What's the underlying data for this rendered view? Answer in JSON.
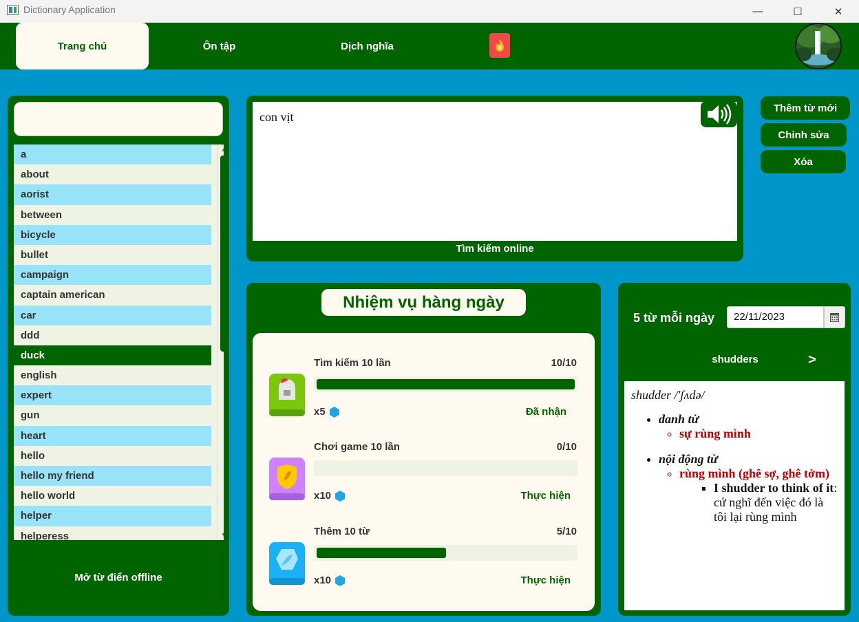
{
  "window": {
    "title": "Dictionary Application",
    "controls": [
      "—",
      "☐",
      "✕"
    ]
  },
  "nav": {
    "tabs": [
      "Trang chủ",
      "Ôn tập",
      "Dịch nghĩa"
    ],
    "active_tab": "Trang chủ",
    "fire_icon": "fire-icon",
    "avatar": "waterfall-avatar"
  },
  "search": {
    "value": "",
    "placeholder": ""
  },
  "word_list": {
    "items": [
      "a",
      "about",
      "aorist",
      "between",
      "bicycle",
      "bullet",
      "campaign",
      "captain american",
      "car",
      "ddd",
      "duck",
      "english",
      "expert",
      "gun",
      "heart",
      "hello",
      "hello my friend",
      "hello world",
      "helper",
      "helperess"
    ],
    "selected": "duck",
    "offline_button": "Mở từ điển offline"
  },
  "translate": {
    "input_text": "con vịt",
    "online_search": "Tìm kiếm online",
    "speaker_icon": "speaker-icon"
  },
  "actions": {
    "add": "Thêm từ mới",
    "edit": "Chỉnh sửa",
    "delete": "Xóa"
  },
  "quests": {
    "title": "Nhiệm vụ hàng ngày",
    "items": [
      {
        "name": "Tìm kiếm 10 lần",
        "progress": "10/10",
        "fraction": 1.0,
        "reward": "x5",
        "status": "Đã nhận",
        "icon": "helmet-icon",
        "icon_color": "#7ac70c"
      },
      {
        "name": "Chơi game 10 lần",
        "progress": "0/10",
        "fraction": 0.0,
        "reward": "x10",
        "status": "Thực hiện",
        "icon": "shield-icon",
        "icon_color": "#ce82ff"
      },
      {
        "name": "Thêm 10 từ",
        "progress": "5/10",
        "fraction": 0.5,
        "reward": "x10",
        "status": "Thực hiện",
        "icon": "feather-icon",
        "icon_color": "#1cb0f6"
      }
    ]
  },
  "daily": {
    "label": "5 từ mỗi ngày",
    "date": "22/11/2023",
    "word": "shudders",
    "next": ">",
    "definition": {
      "headword": "shudder /'ʃʌdə/",
      "pos1": "danh từ",
      "sense1": "sự rùng mình",
      "pos2": "nội động từ",
      "sense2": "rùng mình (ghê sợ, ghê tởm)",
      "example_bold": "I shudder to think of it",
      "example_rest": ": cứ nghĩ đến việc đó là tôi lại rùng mình"
    }
  },
  "colors": {
    "primary": "#006400",
    "background": "#0096c9",
    "cream": "#fffaf0",
    "list_alt": "#99e3f8",
    "accent_red": "#c00000"
  }
}
